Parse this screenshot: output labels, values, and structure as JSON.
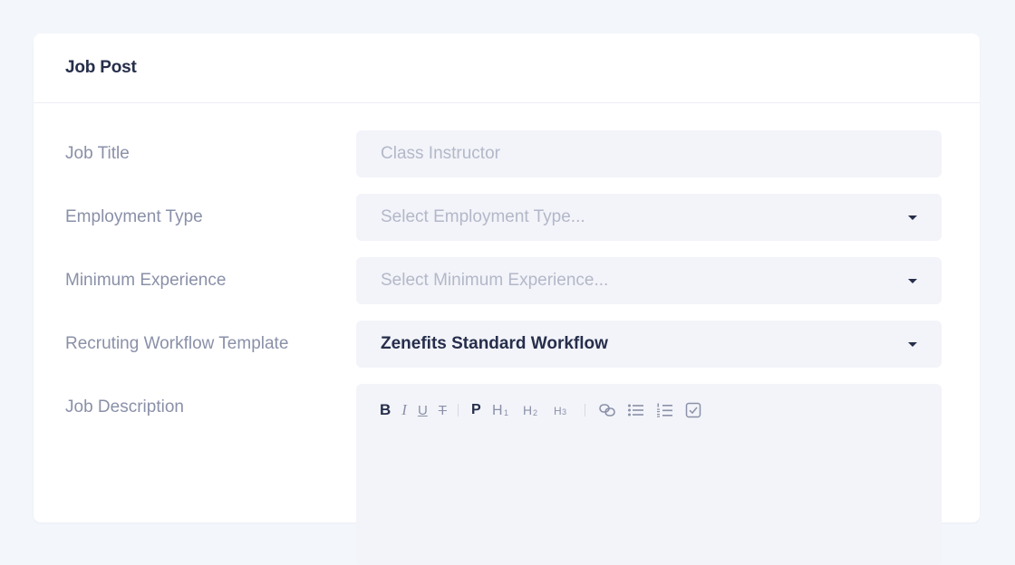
{
  "card": {
    "title": "Job Post"
  },
  "form": {
    "job_title": {
      "label": "Job Title",
      "placeholder": "Class Instructor"
    },
    "employment_type": {
      "label": "Employment Type",
      "placeholder": "Select Employment Type..."
    },
    "minimum_experience": {
      "label": "Minimum Experience",
      "placeholder": "Select Minimum Experience..."
    },
    "workflow_template": {
      "label": "Recruting Workflow Template",
      "value": "Zenefits Standard Workflow"
    },
    "job_description": {
      "label": "Job Description"
    }
  },
  "toolbar": {
    "bold": "B",
    "italic": "I",
    "underline": "U",
    "strike": "T",
    "paragraph": "P",
    "h1": "H1",
    "h2": "H2",
    "h3": "H3",
    "icons": [
      "link-icon",
      "bullet-list-icon",
      "numbered-list-icon",
      "checkbox-list-icon"
    ]
  },
  "colors": {
    "background": "#f3f6fa",
    "card": "#ffffff",
    "field": "#f3f4f9",
    "text_dark": "#262e4b",
    "text_muted": "#8a90a8",
    "placeholder": "#b3b8c9"
  }
}
